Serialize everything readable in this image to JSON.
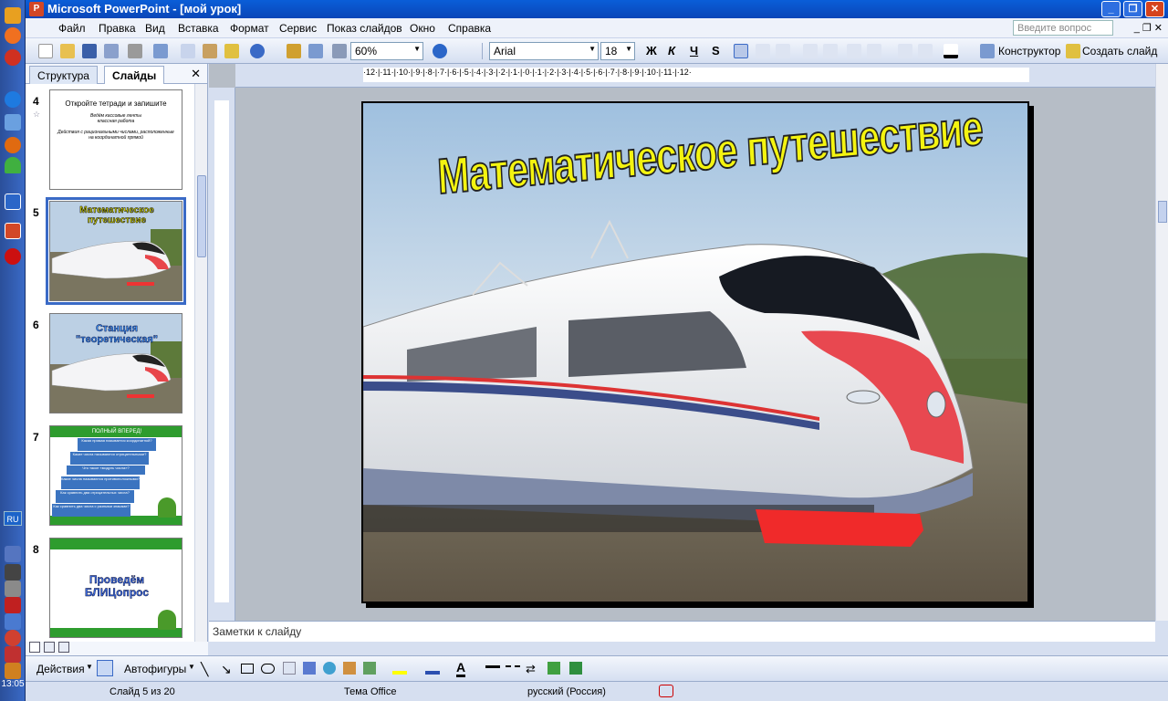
{
  "window": {
    "title": "Microsoft PowerPoint - [мой урок]",
    "app_icon_label": "P"
  },
  "menu": {
    "items": [
      "Файл",
      "Правка",
      "Вид",
      "Вставка",
      "Формат",
      "Сервис",
      "Показ слайдов",
      "Окно",
      "Справка"
    ],
    "ask_placeholder": "Введите вопрос"
  },
  "toolbar": {
    "zoom": "60%",
    "font": "Arial",
    "font_size": "18",
    "bold": "Ж",
    "italic": "К",
    "underline": "Ч",
    "shadow": "S",
    "designer_label": "Конструктор",
    "new_slide_label": "Создать слайд"
  },
  "left_pane": {
    "tab_structure": "Структура",
    "tab_slides": "Слайды",
    "close": "✕",
    "thumbnails": [
      {
        "num": "4",
        "title": "Откройте тетради и запишите",
        "line1": "Ведём кассовые ленты",
        "line2": "классная работа",
        "line3": "Действия с рациональными числами, расположенные на координатной прямой"
      },
      {
        "num": "5",
        "title": "Математическое путешествие"
      },
      {
        "num": "6",
        "title": "Станция \"теоретическая\""
      },
      {
        "num": "7",
        "title": "ПОЛНЫЙ ВПЕРЕД!",
        "items": [
          "Какая прямая называется координатной?",
          "Какие числа называются отрицательными?",
          "Что такое «модуль числа»?",
          "Какие числа называются противоположными?",
          "Как сравнить два отрицательных числа?",
          "Как сравнить два числа с разными знаками?"
        ]
      },
      {
        "num": "8",
        "title": "Проведём БЛИЦопрос"
      }
    ]
  },
  "slide": {
    "title": "Математическое путешествие"
  },
  "ruler": {
    "h_ticks": "·12·|·11·|·10·|·9·|·8·|·7·|·6·|·5·|·4·|·3·|·2·|·1·|·0·|·1·|·2·|·3·|·4·|·5·|·6·|·7·|·8·|·9·|·10·|·11·|·12·"
  },
  "notes": {
    "placeholder": "Заметки к слайду"
  },
  "drawbar": {
    "actions": "Действия",
    "autoshapes": "Автофигуры"
  },
  "status": {
    "slide_counter": "Слайд 5 из 20",
    "theme": "Тема Office",
    "language": "русский (Россия)"
  },
  "taskstrip": {
    "lang": "RU",
    "clock": "13:05"
  }
}
